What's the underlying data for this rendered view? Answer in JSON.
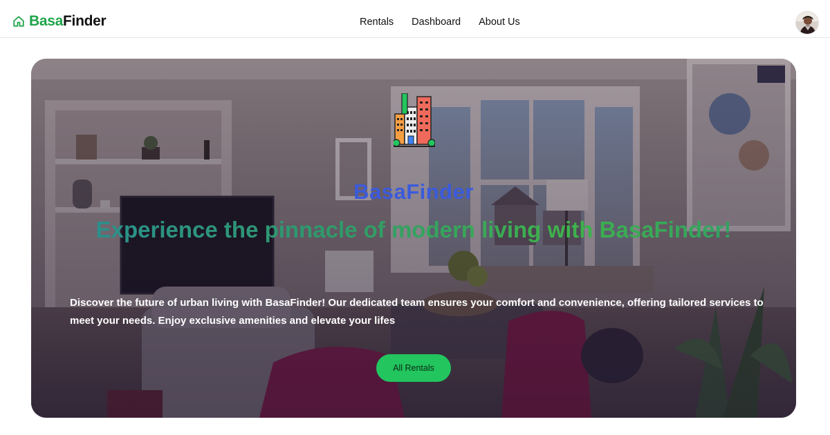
{
  "nav": {
    "brand_part1": "Basa",
    "brand_part2": "Finder",
    "links": [
      "Rentals",
      "Dashboard",
      "About Us"
    ]
  },
  "hero": {
    "brand": "BasaFinder",
    "title": "Experience the pinnacle of modern living with BasaFinder!",
    "description": "Discover the future of urban living with BasaFinder! Our dedicated team ensures your comfort and convenience, offering tailored services to meet your needs. Enjoy exclusive amenities and elevate your lifes",
    "cta_label": "All Rentals"
  },
  "colors": {
    "brand_green": "#1fa34a",
    "cta_green": "#22c55e",
    "hero_brand_blue": "#3b5bdb"
  },
  "icons": [
    "home-icon",
    "buildings-logo-icon",
    "user-avatar"
  ]
}
